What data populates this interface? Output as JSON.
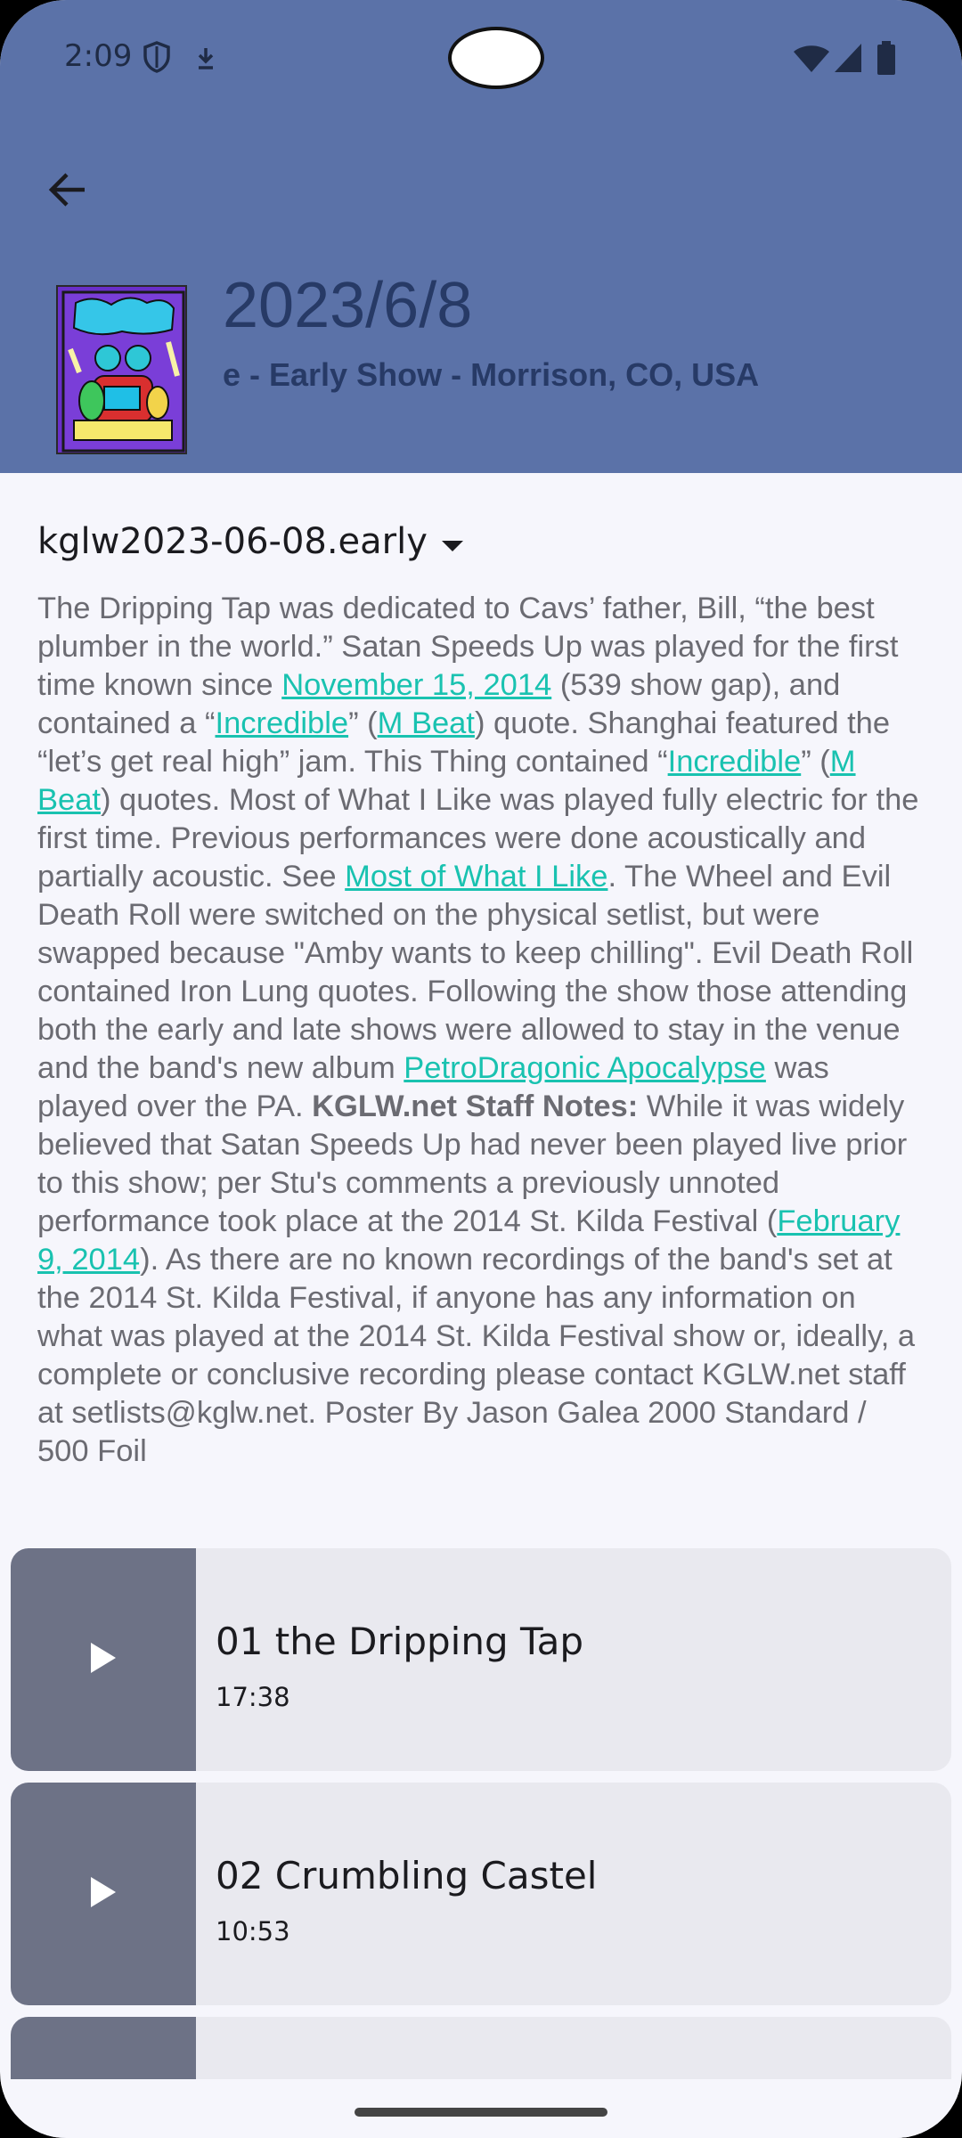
{
  "status_bar": {
    "time": "2:09",
    "icons": [
      "shield-icon",
      "download-icon",
      "wifi-icon",
      "signal-icon",
      "battery-icon"
    ]
  },
  "header": {
    "back_icon": "arrow-left-icon",
    "date": "2023/6/8",
    "venue_visible": "e - Early Show - Morrison, CO, USA",
    "background_color": "#5b72a8"
  },
  "recording": {
    "selected": "kglw2023-06-08.early"
  },
  "notes": {
    "p1": "The Dripping Tap was dedicated to Cavs’ father, Bill, “the best plumber in the world.” Satan Speeds Up was played for the first time known since ",
    "link1": "November 15, 2014",
    "p2": " (539 show gap), and contained a “",
    "link2": "Incredible",
    "p3": "” (",
    "link3": "M Beat",
    "p4": ") quote. Shanghai featured the “let’s get real high” jam. This Thing contained “",
    "link4": "Incredible",
    "p5": "” (",
    "link5": "M Beat",
    "p6": ") quotes. Most of What I Like was played fully electric for the first time. Previous performances were done acoustically and partially acoustic. See ",
    "link6": "Most of What I Like",
    "p7": ". The Wheel and Evil Death Roll were switched on the physical setlist, but were swapped because \"Amby wants to keep chilling\". Evil Death Roll contained Iron Lung quotes. Following the show those attending both the early and late shows were allowed to stay in the venue and the band's new album ",
    "link7": "PetroDragonic Apocalypse",
    "p8": " was played over the PA. ",
    "bold1": "KGLW.net Staff Notes:",
    "p9": " While it was widely believed that Satan Speeds Up had never been played live prior to this show; per Stu's comments a previously unnoted performance took place at the 2014 St. Kilda Festival (",
    "link8": "February 9, 2014",
    "p10": "). As there are no known recordings of the band's set at the 2014 St. Kilda Festival, if anyone has any information on what was played at the 2014 St. Kilda Festival show or, ideally, a complete or conclusive recording please contact KGLW.net staff at setlists@kglw.net. Poster By Jason Galea 2000 Standard / 500 Foil",
    "link_color": "#19c2b0"
  },
  "tracks": [
    {
      "title": "01 the Dripping Tap",
      "duration": "17:38"
    },
    {
      "title": "02 Crumbling Castel",
      "duration": "10:53"
    }
  ]
}
